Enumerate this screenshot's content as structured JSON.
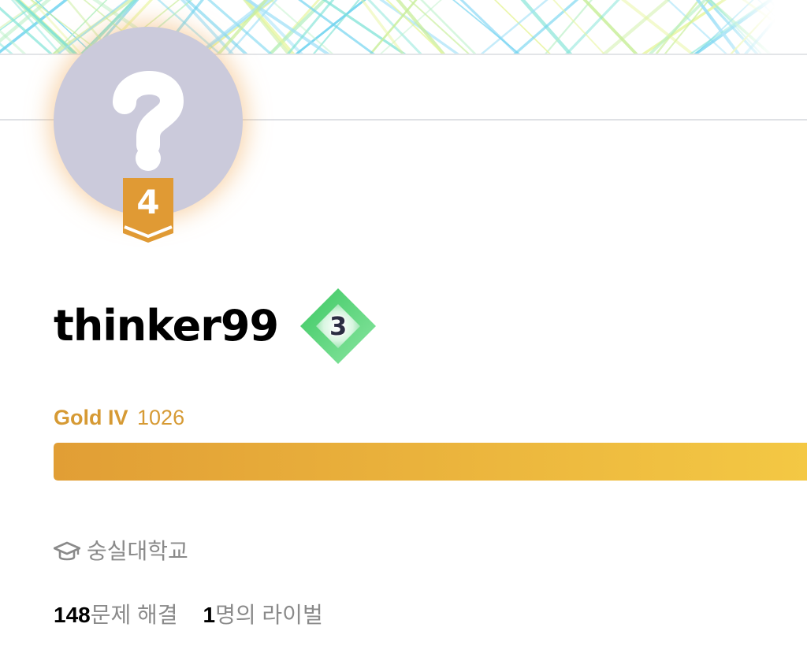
{
  "profile": {
    "username": "thinker99",
    "avatar_glyph": "?",
    "avatar_icon": "question-mark-icon",
    "tier_badge_level": "4",
    "class_badge_level": "3",
    "tier_name": "Gold IV",
    "rating": "1026",
    "tier_progress_fraction": 1.0,
    "school": "숭실대학교",
    "school_icon": "graduation-cap-icon",
    "stats": {
      "solved_count": "148",
      "solved_label": "문제 해결",
      "rival_count": "1",
      "rival_label": "명의 라이벌"
    }
  },
  "colors": {
    "tier_gold": "#d69a34",
    "progress_start": "#e19e35",
    "progress_end": "#f4c944",
    "avatar_bg": "#cbcadb",
    "class_badge_green": "#5fd27e",
    "muted_text": "#8a8a8a"
  }
}
